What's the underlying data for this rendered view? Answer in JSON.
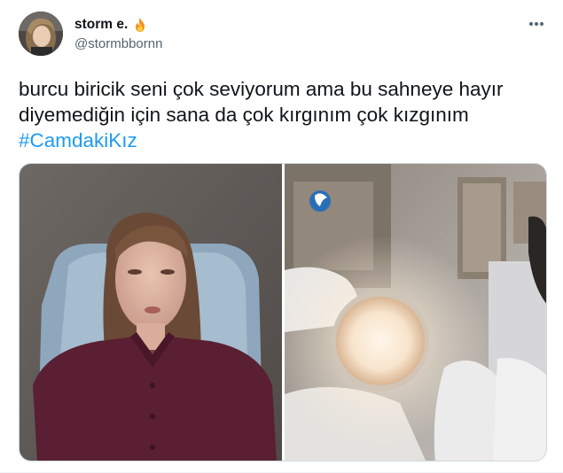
{
  "author": {
    "display_name": "storm e.",
    "handle": "@stormbbornn",
    "name_emoji": "fire-icon"
  },
  "tweet": {
    "text": "burcu biricik seni çok seviyorum ama bu sahneye hayır diyemediğin için sana da çok kırgınım çok kızgınım",
    "hashtag": "#CamdakiKız"
  },
  "media": {
    "count": 2,
    "left_photo": "woman-lying-on-examination-chair",
    "right_photo": "examination-lamp-glow"
  },
  "colors": {
    "text": "#0f1419",
    "secondary": "#536471",
    "link": "#1d9bf0"
  }
}
